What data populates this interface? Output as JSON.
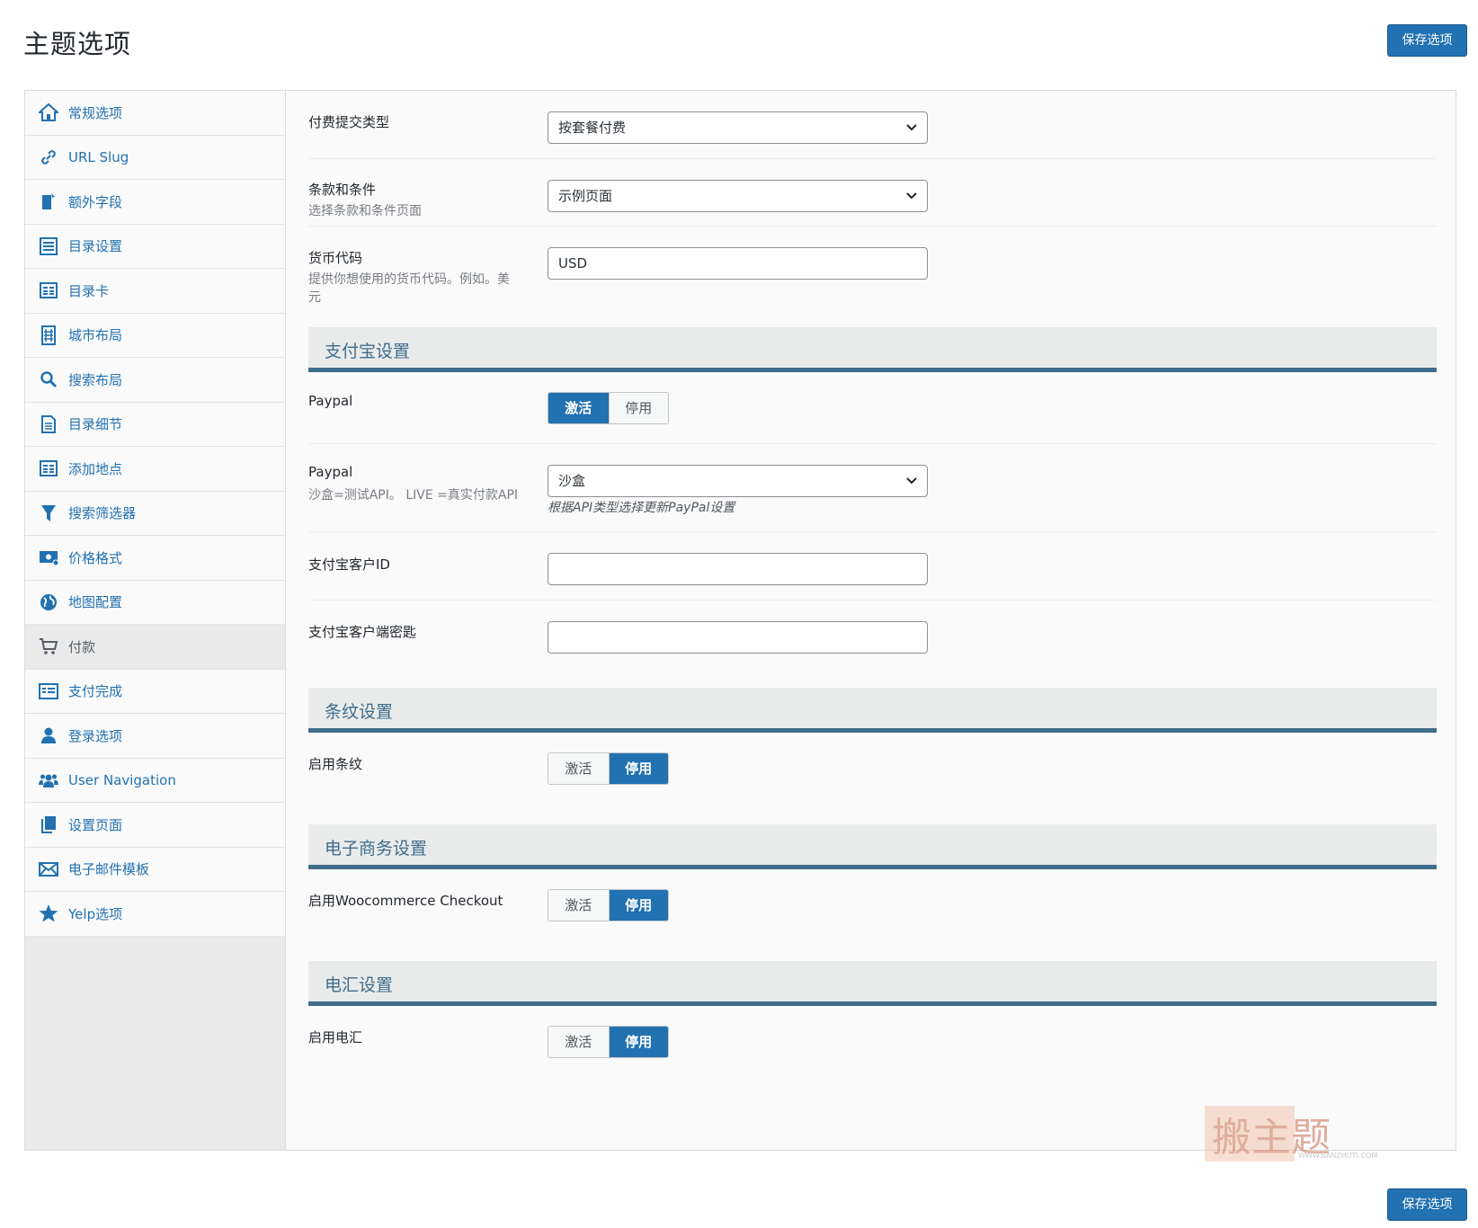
{
  "header": {
    "title": "主题选项",
    "save_label": "保存选项"
  },
  "footer": {
    "save_label": "保存选项"
  },
  "sidebar": {
    "items": [
      {
        "label": "常规选项",
        "icon": "home-group-icon"
      },
      {
        "label": "URL Slug",
        "icon": "link-icon"
      },
      {
        "label": "额外字段",
        "icon": "document-edit-icon"
      },
      {
        "label": "目录设置",
        "icon": "list-icon"
      },
      {
        "label": "目录卡",
        "icon": "card-grid-icon"
      },
      {
        "label": "城市布局",
        "icon": "building-icon"
      },
      {
        "label": "搜索布局",
        "icon": "search-icon"
      },
      {
        "label": "目录细节",
        "icon": "page-icon"
      },
      {
        "label": "添加地点",
        "icon": "card-grid-icon"
      },
      {
        "label": "搜索筛选器",
        "icon": "filter-icon"
      },
      {
        "label": "价格格式",
        "icon": "money-icon"
      },
      {
        "label": "地图配置",
        "icon": "globe-icon"
      },
      {
        "label": "付款",
        "icon": "cart-icon"
      },
      {
        "label": "支付完成",
        "icon": "receipt-icon"
      },
      {
        "label": "登录选项",
        "icon": "user-icon"
      },
      {
        "label": "User Navigation",
        "icon": "users-icon"
      },
      {
        "label": "设置页面",
        "icon": "pages-icon"
      },
      {
        "label": "电子邮件模板",
        "icon": "mail-icon"
      },
      {
        "label": "Yelp选项",
        "icon": "star-icon"
      }
    ],
    "active_index": 12
  },
  "main": {
    "payment_type": {
      "label": "付费提交类型",
      "value": "按套餐付费"
    },
    "terms": {
      "label": "条款和条件",
      "desc": "选择条款和条件页面",
      "value": "示例页面"
    },
    "currency": {
      "label": "货币代码",
      "desc": "提供你想使用的货币代码。例如。美元",
      "value": "USD"
    },
    "alipay_section": {
      "title": "支付宝设置"
    },
    "paypal_toggle": {
      "label": "Paypal",
      "on": "激活",
      "off": "停用",
      "state": "on"
    },
    "paypal_api": {
      "label": "Paypal",
      "desc": "沙盒=测试API。 LIVE =真实付款API",
      "value": "沙盒",
      "note": "根据API类型选择更新PayPal设置"
    },
    "alipay_client_id": {
      "label": "支付宝客户ID",
      "value": ""
    },
    "alipay_client_key": {
      "label": "支付宝客户端密匙",
      "value": ""
    },
    "stripe_section": {
      "title": "条纹设置"
    },
    "stripe_toggle": {
      "label": "启用条纹",
      "on": "激活",
      "off": "停用",
      "state": "off"
    },
    "ecommerce_section": {
      "title": "电子商务设置"
    },
    "woo_toggle": {
      "label": "启用Woocommerce Checkout",
      "on": "激活",
      "off": "停用",
      "state": "off"
    },
    "wire_section": {
      "title": "电汇设置"
    },
    "wire_toggle": {
      "label": "启用电汇",
      "on": "激活",
      "off": "停用",
      "state": "off"
    }
  },
  "watermark": {
    "text": "搬主题",
    "url": "WWW.BANZHUTI.COM"
  },
  "colors": {
    "accent": "#2271b1",
    "section_bar": "#3f6d8c"
  }
}
